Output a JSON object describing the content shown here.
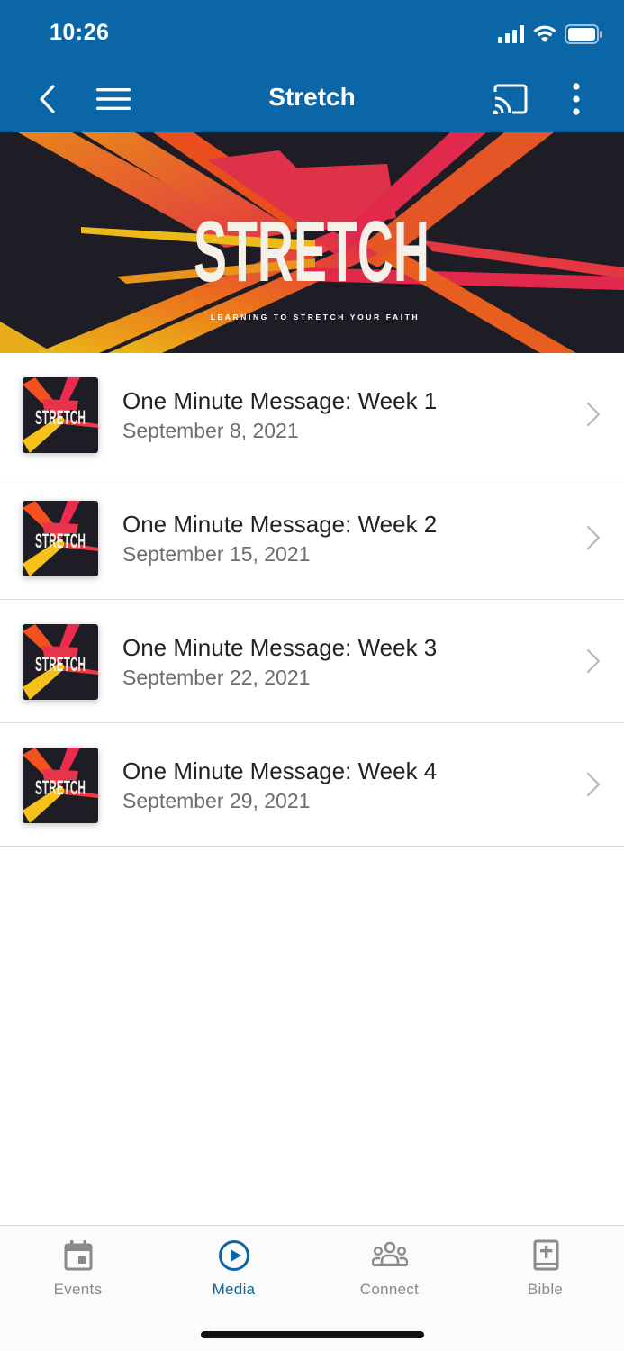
{
  "status_bar": {
    "time": "10:26"
  },
  "header": {
    "title": "Stretch"
  },
  "banner": {
    "title": "STRETCH",
    "subtitle": "LEARNING TO STRETCH YOUR FAITH"
  },
  "thumb_text": "STRETCH",
  "messages": [
    {
      "title": "One Minute Message: Week 1",
      "date": "September 8, 2021"
    },
    {
      "title": "One Minute Message: Week 2",
      "date": "September 15, 2021"
    },
    {
      "title": "One Minute Message: Week 3",
      "date": "September 22, 2021"
    },
    {
      "title": "One Minute Message: Week 4",
      "date": "September 29, 2021"
    }
  ],
  "tabs": [
    {
      "label": "Events",
      "icon": "calendar-icon",
      "active": false
    },
    {
      "label": "Media",
      "icon": "play-circle-icon",
      "active": true
    },
    {
      "label": "Connect",
      "icon": "people-icon",
      "active": false
    },
    {
      "label": "Bible",
      "icon": "bible-icon",
      "active": false
    }
  ],
  "colors": {
    "header": "#0a66a6",
    "accent": "#0a66a6",
    "inactive": "#8a8a8a"
  }
}
